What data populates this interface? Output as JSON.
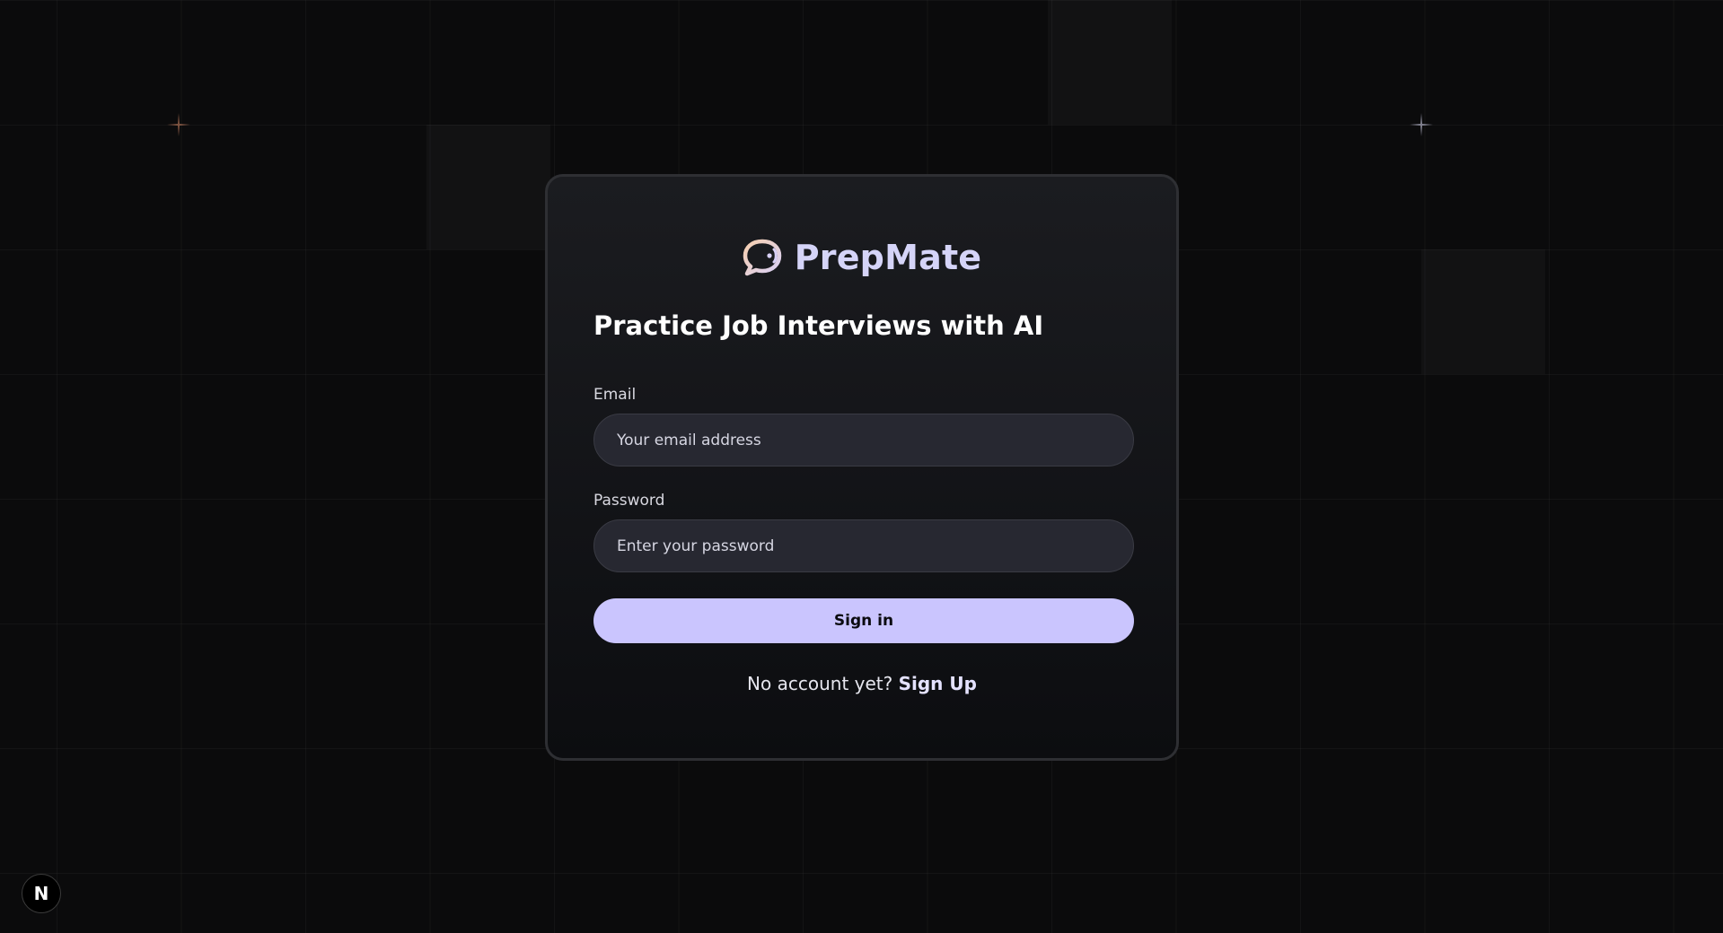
{
  "brand": {
    "name": "PrepMate",
    "logo_icon": "chat-bubble-voice-icon",
    "primary_color": "#cac5fe",
    "logo_accent": "#f3c9a8"
  },
  "headline": "Practice Job Interviews with AI",
  "form": {
    "email_label": "Email",
    "email_placeholder": "Your email address",
    "password_label": "Password",
    "password_placeholder": "Enter your password",
    "submit_label": "Sign in"
  },
  "footer": {
    "prompt": "No account yet?",
    "link_label": "Sign Up"
  },
  "dev_badge": {
    "label": "N"
  }
}
